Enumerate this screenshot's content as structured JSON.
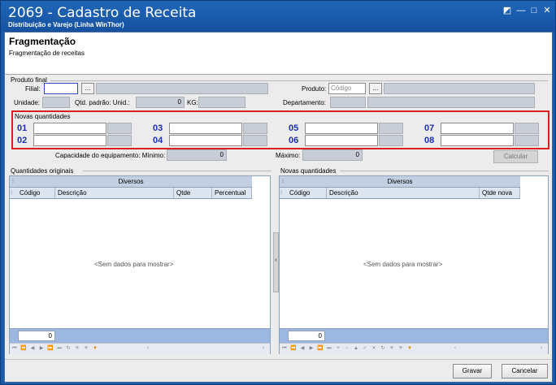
{
  "window": {
    "title": "2069 - Cadastro de Receita",
    "subtitle": "Distribuição e Varejo (Linha WinThor)",
    "controls": {
      "restore": "◩",
      "minimize": "—",
      "maximize": "□",
      "close": "✕"
    }
  },
  "header": {
    "title": "Fragmentação",
    "subtitle": "Fragmentação de receitas"
  },
  "produto_final": {
    "group_label": "Produto final",
    "filial_label": "Filial:",
    "filial_value": "",
    "unidade_label": "Unidade:",
    "qtd_padrao_label": "Qtd. padrão: Unid.:",
    "qtd_padrao_value": "0",
    "kg_label": "KG:",
    "produto_label": "Produto:",
    "produto_placeholder": "Código",
    "departamento_label": "Departamento:",
    "dots_label": "..."
  },
  "novas_quantidades_form": {
    "group_label": "Novas quantidades",
    "slots": [
      {
        "num": "01"
      },
      {
        "num": "02"
      },
      {
        "num": "03"
      },
      {
        "num": "04"
      },
      {
        "num": "05"
      },
      {
        "num": "06"
      },
      {
        "num": "07"
      },
      {
        "num": "08"
      }
    ]
  },
  "capacidade": {
    "label": "Capacidade do equipamento: Mínimo:",
    "minimo_value": "0",
    "maximo_label": "Máximo:",
    "maximo_value": "0",
    "calcular_label": "Calcular"
  },
  "grid_left": {
    "group_label": "Quantidades originais",
    "band": "Diversos",
    "columns": [
      "Código",
      "Descrição",
      "Qtde",
      "Percentual"
    ],
    "empty_text": "<Sem dados para mostrar>",
    "footer_value": "0"
  },
  "grid_right": {
    "group_label": "Novas quantidades",
    "band": "Diversos",
    "columns": [
      "Código",
      "Descrição",
      "Qtde nova"
    ],
    "empty_text": "<Sem dados para mostrar>",
    "footer_value": "0"
  },
  "buttons": {
    "gravar": "Gravar",
    "cancelar": "Cancelar"
  },
  "colors": {
    "title_bar": "#1652a0",
    "highlight_border": "#d81e1e",
    "number_blue": "#1c2fb2",
    "readonly_fill": "#c9ced6"
  }
}
